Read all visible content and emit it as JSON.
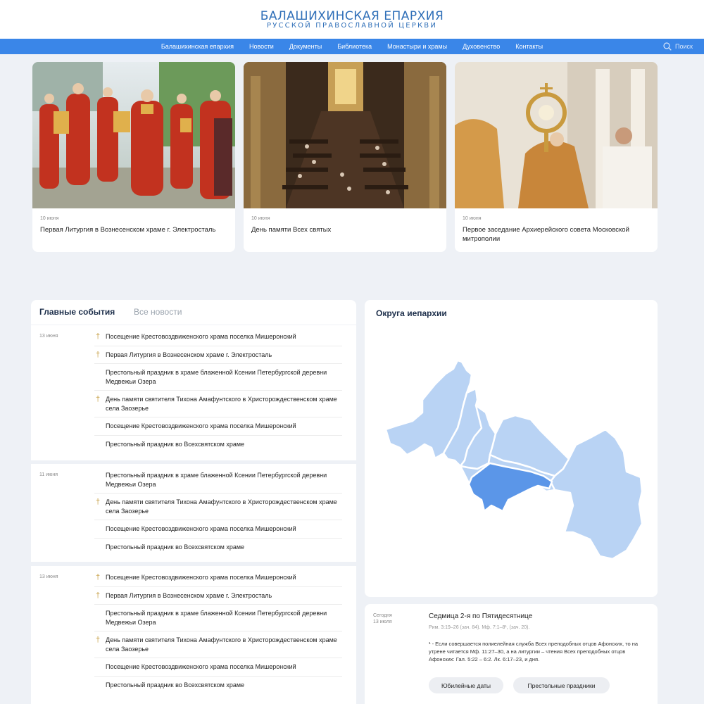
{
  "header": {
    "title": "БАЛАШИХИНСКАЯ ЕПАРХИЯ",
    "subtitle": "РУССКОЙ ПРАВОСЛАВНОЙ ЦЕРКВИ"
  },
  "nav": {
    "items": [
      "Балашихинская епархия",
      "Новости",
      "Документы",
      "Библиотека",
      "Монастыри и храмы",
      "Духовенство",
      "Контакты"
    ],
    "search_label": "Поиск",
    "search_icon": "search-icon"
  },
  "news": [
    {
      "date": "10 июня",
      "title": "Первая Литургия в Вознесенском храме г. Электросталь"
    },
    {
      "date": "10 июня",
      "title": "День памяти Всех святых"
    },
    {
      "date": "10 июня",
      "title": "Первое заседание Архиерейского совета Московской митрополии"
    }
  ],
  "events": {
    "tab_main": "Главные события",
    "tab_all": "Все новости",
    "groups": [
      {
        "date": "13 июня",
        "items": [
          {
            "text": "Посещение Крестовоздвиженского храма поселка Мишеронский",
            "cross": true
          },
          {
            "text": "Первая Литургия в Вознесенском храме г. Электросталь",
            "cross": true
          },
          {
            "text": "Престольный праздник в храме блаженной Ксении Петербургской деревни Медвежьи Озера",
            "cross": false
          },
          {
            "text": "День памяти святителя Тихона Амафунтского в Христорождественском храме села Заозерье",
            "cross": true
          },
          {
            "text": "Посещение Крестовоздвиженского храма поселка Мишеронский",
            "cross": false
          },
          {
            "text": "Престольный праздник во Всехсвятском храме",
            "cross": false
          }
        ]
      },
      {
        "date": "11 июня",
        "items": [
          {
            "text": "Престольный праздник в храме блаженной Ксении Петербургской деревни Медвежьи Озера",
            "cross": false
          },
          {
            "text": "День памяти святителя Тихона Амафунтского в Христорождественском храме села Заозерье",
            "cross": true
          },
          {
            "text": "Посещение Крестовоздвиженского храма поселка Мишеронский",
            "cross": false
          },
          {
            "text": "Престольный праздник во Всехсвятском храме",
            "cross": false
          }
        ]
      },
      {
        "date": "13 июня",
        "items": [
          {
            "text": "Посещение Крестовоздвиженского храма поселка Мишеронский",
            "cross": true
          },
          {
            "text": "Первая Литургия в Вознесенском храме г. Электросталь",
            "cross": true
          },
          {
            "text": "Престольный праздник в храме блаженной Ксении Петербургской деревни Медвежьи Озера",
            "cross": false
          },
          {
            "text": "День памяти святителя Тихона Амафунтского в Христорождественском храме села Заозерье",
            "cross": true
          },
          {
            "text": "Посещение Крестовоздвиженского храма поселка Мишеронский",
            "cross": false
          },
          {
            "text": "Престольный праздник во Всехсвятском храме",
            "cross": false
          }
        ]
      }
    ]
  },
  "map": {
    "title": "Округа иепархии",
    "region_color": "#b9d3f4",
    "selected_color": "#5b96e8"
  },
  "calendar": {
    "today_label": "Сегодня",
    "date": "13 июля",
    "title": "Седмица 2-я по Пятидесятнице",
    "readings": "Рим. 3:19–26 (зач. 84). Мф. 7:1–8¹, (зач. 20).",
    "note": "¹ - Если совершается полиелейная служба Всех преподобных отцов Афонских, то на утрене читается Мф. 11:27–30, а на литургии – чтения Всех преподобных отцов Афонских: Гал. 5:22 – 6:2. Лк. 6:17–23, и дня.",
    "buttons": [
      "Юбилейные даты",
      "Престольные праздники"
    ]
  },
  "colors": {
    "accent": "#3a86e8",
    "brand": "#2f6fb8",
    "background": "#eef1f6",
    "cross": "#c8a24a"
  }
}
